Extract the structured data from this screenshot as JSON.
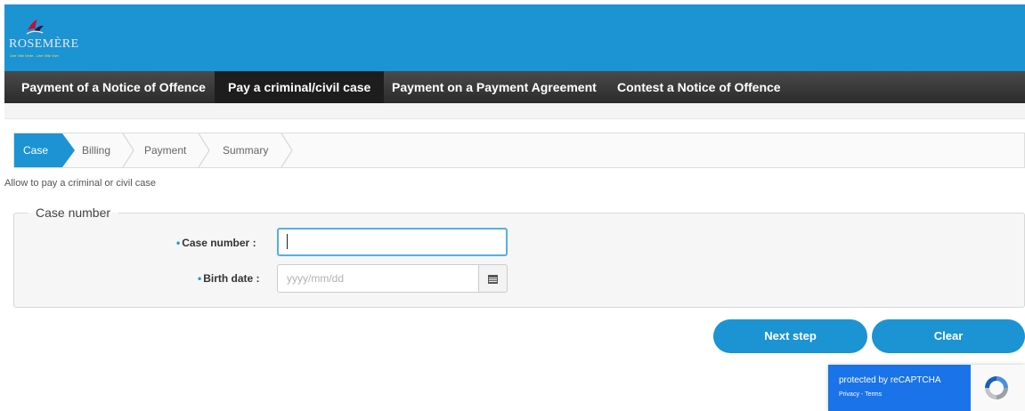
{
  "header": {
    "logo_text": "ROSEMÈRE",
    "logo_tagline": "Une Ville Verte - Une Ville Vive"
  },
  "nav": {
    "items": [
      {
        "label": "Payment of a Notice of Offence"
      },
      {
        "label": "Pay a criminal/civil case"
      },
      {
        "label": "Payment on a Payment Agreement"
      },
      {
        "label": "Contest a Notice of Offence"
      }
    ],
    "active_index": 1
  },
  "steps": {
    "items": [
      {
        "label": "Case"
      },
      {
        "label": "Billing"
      },
      {
        "label": "Payment"
      },
      {
        "label": "Summary"
      }
    ],
    "active_index": 0
  },
  "description": "Allow to pay a criminal or civil case",
  "form": {
    "legend": "Case number",
    "case_number_label": "Case number :",
    "case_number_value": "",
    "birth_date_label": "Birth date :",
    "birth_date_placeholder": "yyyy/mm/dd",
    "required_marker": "•"
  },
  "buttons": {
    "next_label": "Next step",
    "clear_label": "Clear"
  },
  "recaptcha": {
    "protected_text": "protected by reCAPTCHA",
    "privacy_label": "Privacy",
    "separator": " - ",
    "terms_label": "Terms"
  },
  "colors": {
    "brand_blue": "#1c93d3",
    "nav_dark": "#2b2b2b",
    "recaptcha_blue": "#1a73e8"
  }
}
